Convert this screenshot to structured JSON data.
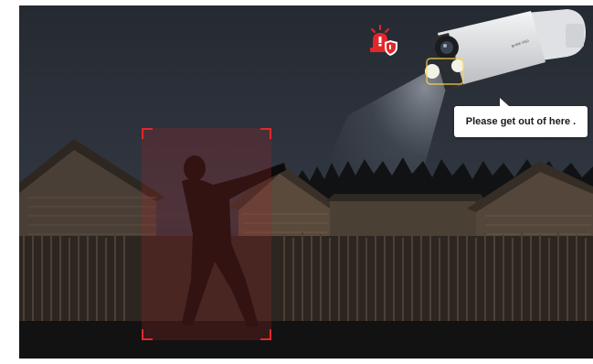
{
  "camera": {
    "brand_text": "tp-link VIGI"
  },
  "speech_bubble": {
    "text": "Please get out of here ."
  },
  "colors": {
    "alert_red": "#e0282a",
    "sky": "#2b3038",
    "ground": "#151515"
  },
  "icons": {
    "alarm": "siren-with-shield-icon"
  }
}
